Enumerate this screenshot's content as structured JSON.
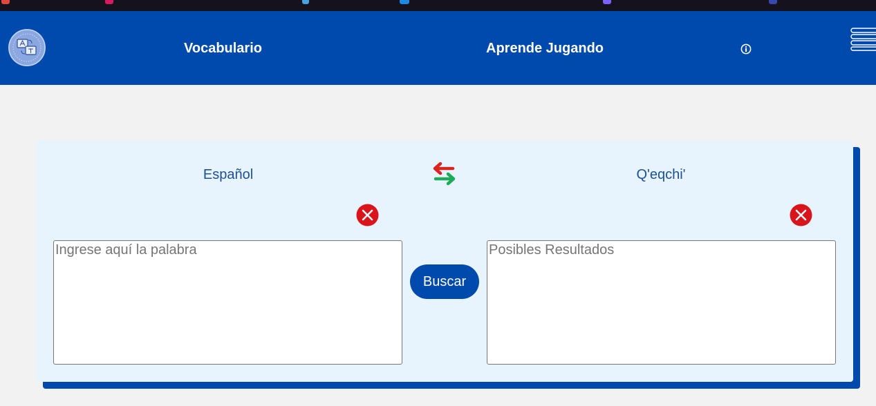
{
  "nav": {
    "vocabulary_label": "Vocabulario",
    "learn_playing_label": "Aprende Jugando",
    "info_icon": "info-icon",
    "menu_icon": "hamburger-menu-icon",
    "logo_icon": "translation-logo"
  },
  "translator": {
    "source_language": "Español",
    "target_language": "Q'eqchi'",
    "swap_icon": "swap-arrows-icon",
    "clear_icon": "close-circle-icon",
    "input_placeholder": "Ingrese aquí la palabra",
    "output_placeholder": "Posibles Resultados",
    "search_button": "Buscar"
  },
  "colors": {
    "brand_blue": "#004aad",
    "card_background": "#e8f4fd",
    "page_background": "#f2f2f2",
    "label_text": "#1c4f96",
    "clear_red": "#d9151b",
    "swap_red": "#d9251d",
    "swap_green": "#1faa5a"
  }
}
